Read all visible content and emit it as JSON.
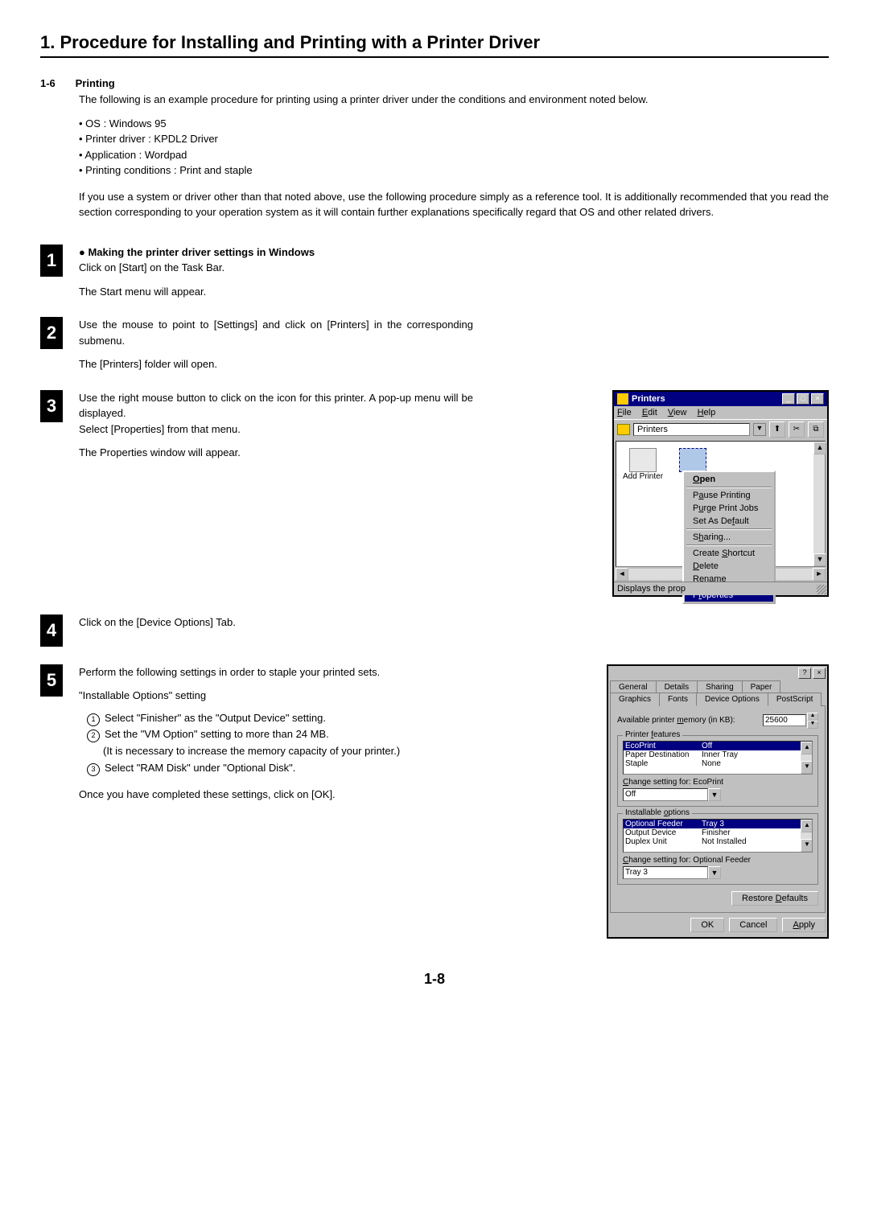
{
  "chapter_title": "1. Procedure for Installing and Printing with a Printer Driver",
  "section": {
    "num": "1-6",
    "title": "Printing"
  },
  "intro": "The following is an example procedure for printing using a printer driver under the conditions and environment noted below.",
  "bullets": [
    "OS : Windows 95",
    "Printer driver : KPDL2 Driver",
    "Application : Wordpad",
    "Printing conditions : Print and staple"
  ],
  "note": "If you use a system or driver other than that noted above, use the following procedure simply as a reference tool. It is additionally recommended that you read the section corresponding to your operation system as it will contain further explanations specifically regard that OS and other related drivers.",
  "steps": {
    "s1": {
      "heading": "● Making the printer driver settings in Windows",
      "line1": "Click on [Start] on the Task Bar.",
      "line2": "The Start menu will appear."
    },
    "s2": {
      "line1": "Use the mouse to point to [Settings] and click on [Printers] in the corresponding submenu.",
      "line2": "The [Printers] folder will open."
    },
    "s3": {
      "line1": "Use the right mouse button to click on the icon for this printer. A pop-up menu will be displayed.",
      "line2": "Select [Properties] from that menu.",
      "line3": "The Properties window will appear."
    },
    "s4": {
      "line1": "Click on the [Device Options] Tab."
    },
    "s5": {
      "line1": "Perform the following settings in order to staple your printed sets.",
      "line2": "\"Installable Options\" setting",
      "sub1": "Select \"Finisher\" as the \"Output Device\" setting.",
      "sub2": "Set the \"VM Option\" setting to more than 24 MB.",
      "sub2b": "(It is necessary to increase the memory capacity of your printer.)",
      "sub3": "Select \"RAM Disk\" under \"Optional Disk\".",
      "line3": "Once you have completed these settings, click on [OK]."
    }
  },
  "printers_win": {
    "title": "Printers",
    "menu": {
      "file": "File",
      "edit": "Edit",
      "view": "View",
      "help": "Help"
    },
    "address": "Printers",
    "icon_add": "Add Printer",
    "context": {
      "open": "Open",
      "pause": "Pause Printing",
      "purge": "Purge Print Jobs",
      "default": "Set As Default",
      "sharing": "Sharing...",
      "shortcut": "Create Shortcut",
      "delete": "Delete",
      "rename": "Rename",
      "properties": "Properties"
    },
    "status": "Displays the prop"
  },
  "props_win": {
    "tabs": {
      "general": "General",
      "details": "Details",
      "sharing": "Sharing",
      "paper": "Paper",
      "graphics": "Graphics",
      "fonts": "Fonts",
      "device": "Device Options",
      "postscript": "PostScript"
    },
    "mem_label": "Available printer memory (in KB):",
    "mem_value": "25600",
    "group_features": "Printer features",
    "features": {
      "eco": {
        "k": "EcoPrint",
        "v": "Off"
      },
      "dest": {
        "k": "Paper Destination",
        "v": "Inner Tray"
      },
      "staple": {
        "k": "Staple",
        "v": "None"
      }
    },
    "change_feat_label": "Change setting for: EcoPrint",
    "change_feat_value": "Off",
    "group_install": "Installable options",
    "install": {
      "feeder": {
        "k": "Optional Feeder",
        "v": "Tray 3"
      },
      "output": {
        "k": "Output Device",
        "v": "Finisher"
      },
      "duplex": {
        "k": "Duplex Unit",
        "v": "Not Installed"
      }
    },
    "change_inst_label": "Change setting for: Optional Feeder",
    "change_inst_value": "Tray 3",
    "restore": "Restore Defaults",
    "ok": "OK",
    "cancel": "Cancel",
    "apply": "Apply"
  },
  "page_num": "1-8"
}
